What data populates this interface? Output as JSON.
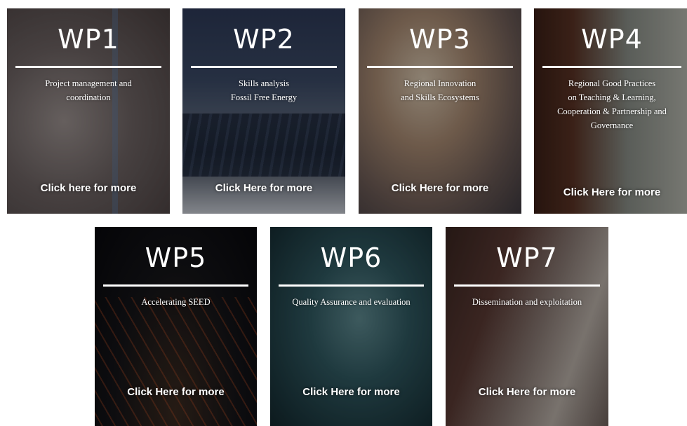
{
  "cards": [
    {
      "title": "WP1",
      "description": "Project management and\ncoordination",
      "cta": "Click here for more"
    },
    {
      "title": "WP2",
      "description": "Skills analysis\nFossil Free Energy",
      "cta": "Click Here for more"
    },
    {
      "title": "WP3",
      "description": "Regional Innovation\nand Skills Ecosystems",
      "cta": "Click Here for more"
    },
    {
      "title": "WP4",
      "description": "Regional Good Practices\non Teaching & Learning,\nCooperation & Partnership and\nGovernance",
      "cta": "Click Here for more"
    },
    {
      "title": "WP5",
      "description": "Accelerating SEED",
      "cta": "Click Here for more"
    },
    {
      "title": "WP6",
      "description": "Quality Assurance and evaluation",
      "cta": "Click Here for more"
    },
    {
      "title": "WP7",
      "description": "Dissemination and exploitation",
      "cta": "Click Here for more"
    }
  ]
}
